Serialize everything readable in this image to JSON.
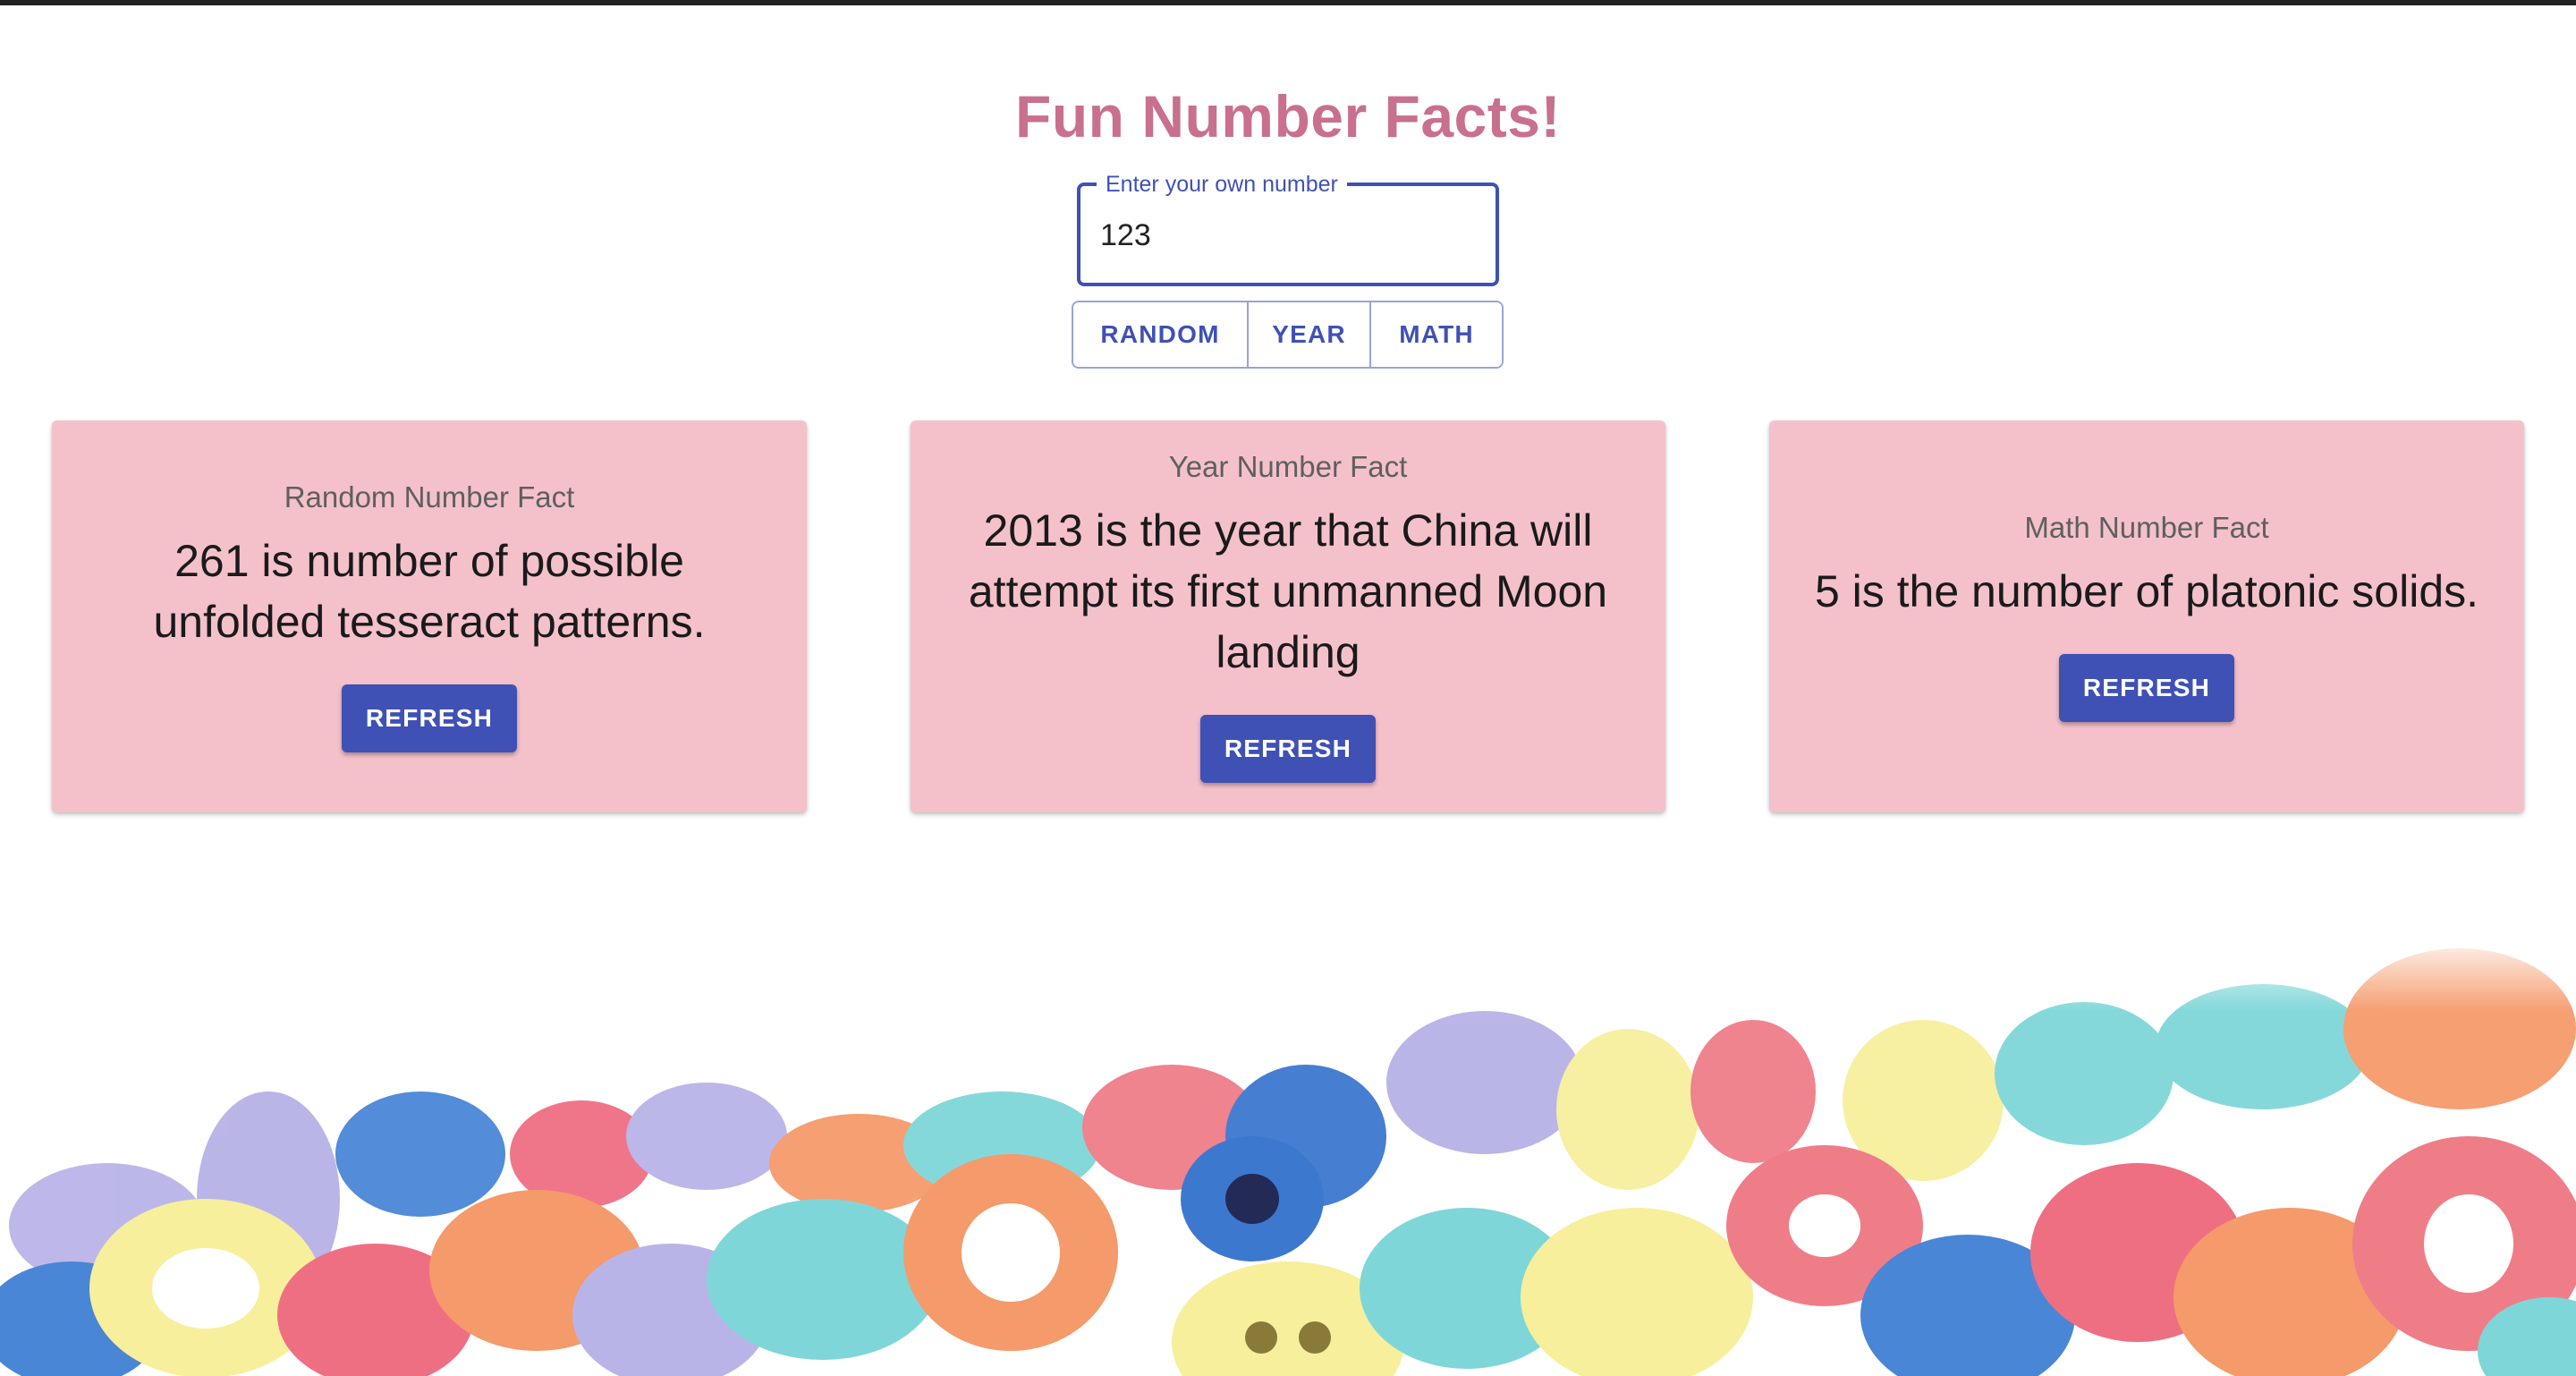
{
  "header": {
    "title": "Fun Number Facts!"
  },
  "number_input": {
    "label": "Enter your own number",
    "value": "123"
  },
  "category_buttons": [
    {
      "label": "RANDOM"
    },
    {
      "label": "YEAR"
    },
    {
      "label": "MATH"
    }
  ],
  "cards": [
    {
      "label": "Random Number Fact",
      "fact": "261 is number of possible unfolded tesseract patterns.",
      "button": "REFRESH"
    },
    {
      "label": "Year Number Fact",
      "fact": "2013 is the year that China will attempt its first unmanned Moon landing",
      "button": "REFRESH"
    },
    {
      "label": "Math Number Fact",
      "fact": "5 is the number of platonic solids.",
      "button": "REFRESH"
    }
  ],
  "decoration": {
    "description_icon": "foam-numbers-image"
  },
  "colors": {
    "title": "#c9708f",
    "primary": "#3f51b5",
    "card_background": "#f4c1cb"
  }
}
